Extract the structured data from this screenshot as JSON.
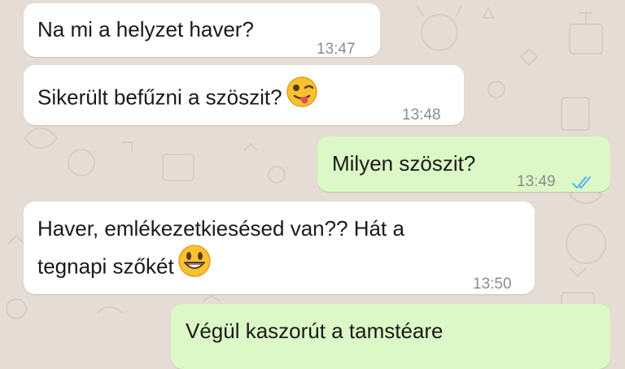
{
  "messages": [
    {
      "direction": "incoming",
      "text": "Na mi a helyzet haver?",
      "time": "13:47"
    },
    {
      "direction": "incoming",
      "text": "Sikerült befűzni a szöszit?",
      "time": "13:48",
      "emoji": "winking-tongue-face-icon"
    },
    {
      "direction": "outgoing",
      "text": "Milyen szöszit?",
      "time": "13:49",
      "status_icon": "double-check-read-icon"
    },
    {
      "direction": "incoming",
      "line1": "Haver, emlékezetkiesésed van?? Hát a",
      "line2": "tegnapi szőkét",
      "time": "13:50",
      "emoji": "grinning-face-icon"
    },
    {
      "direction": "outgoing",
      "text": "Végül kaszorút a tamstéare",
      "time": ""
    }
  ],
  "colors": {
    "wallpaper": "#e5ddd5",
    "incoming_bubble": "#ffffff",
    "outgoing_bubble": "#dcf8c6",
    "read_ticks": "#4fb6ec",
    "timestamp": "#8c8c8c"
  }
}
